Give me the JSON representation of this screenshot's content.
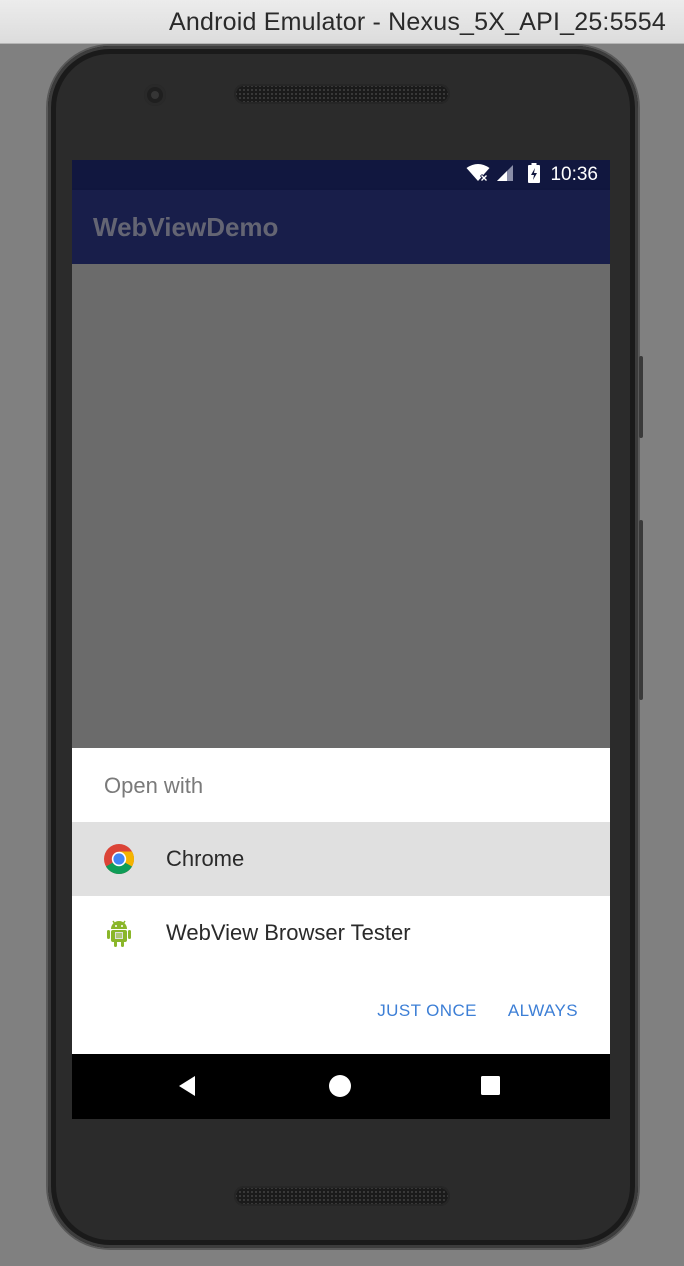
{
  "window": {
    "title": "Android Emulator - Nexus_5X_API_25:5554"
  },
  "status_bar": {
    "time": "10:36",
    "icons": [
      "wifi-icon",
      "signal-icon",
      "battery-charging-icon"
    ]
  },
  "app_bar": {
    "title": "WebViewDemo"
  },
  "chooser": {
    "title": "Open with",
    "items": [
      {
        "label": "Chrome",
        "icon": "chrome-icon",
        "selected": true
      },
      {
        "label": "WebView Browser Tester",
        "icon": "android-icon",
        "selected": false
      }
    ],
    "actions": {
      "just_once": "JUST ONCE",
      "always": "ALWAYS"
    }
  },
  "nav_bar": {
    "buttons": [
      "back-icon",
      "home-icon",
      "recents-icon"
    ]
  },
  "colors": {
    "status_bar": "#11173f",
    "app_bar": "#181e4a",
    "accent": "#3d7fd6",
    "selected_row": "#e0e0e0"
  }
}
